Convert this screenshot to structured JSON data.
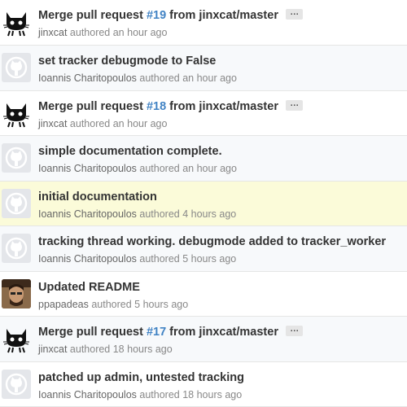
{
  "commits": [
    {
      "avatar": "jinxcat-avatar",
      "title": "Merge pull request ",
      "pr": "#19",
      "rest": " from jinxcat/master",
      "ellipsis": "…",
      "author": "jinxcat",
      "authored": " authored ",
      "time": "an hour ago",
      "style": "normal"
    },
    {
      "avatar": "octocat-avatar",
      "title": "set tracker debugmode to False",
      "author": "Ioannis Charitopoulos",
      "authored": " authored ",
      "time": "an hour ago",
      "style": "alt"
    },
    {
      "avatar": "jinxcat-avatar",
      "title": "Merge pull request ",
      "pr": "#18",
      "rest": " from jinxcat/master",
      "ellipsis": "…",
      "author": "jinxcat",
      "authored": " authored ",
      "time": "an hour ago",
      "style": "normal"
    },
    {
      "avatar": "octocat-avatar",
      "title": "simple documentation complete.",
      "author": "Ioannis Charitopoulos",
      "authored": " authored ",
      "time": "an hour ago",
      "style": "alt"
    },
    {
      "avatar": "octocat-avatar",
      "title": "initial documentation",
      "author": "Ioannis Charitopoulos",
      "authored": " authored ",
      "time": "4 hours ago",
      "style": "highlight"
    },
    {
      "avatar": "octocat-avatar",
      "title": "tracking thread working. debugmode added to tracker_worker",
      "author": "Ioannis Charitopoulos",
      "authored": " authored ",
      "time": "5 hours ago",
      "style": "alt"
    },
    {
      "avatar": "ppapadeas-photo",
      "title": "Updated README",
      "author": "ppapadeas",
      "authored": " authored ",
      "time": "5 hours ago",
      "style": "normal"
    },
    {
      "avatar": "jinxcat-avatar",
      "title": "Merge pull request ",
      "pr": "#17",
      "rest": " from jinxcat/master",
      "ellipsis": "…",
      "author": "jinxcat",
      "authored": " authored ",
      "time": "18 hours ago",
      "style": "alt"
    },
    {
      "avatar": "octocat-avatar",
      "title": "patched up admin, untested tracking",
      "author": "Ioannis Charitopoulos",
      "authored": " authored ",
      "time": "18 hours ago",
      "style": "normal"
    }
  ],
  "colors": {
    "link": "#4183c4",
    "highlight_row": "#fbfbd9",
    "alt_row": "#f7f9fb"
  }
}
